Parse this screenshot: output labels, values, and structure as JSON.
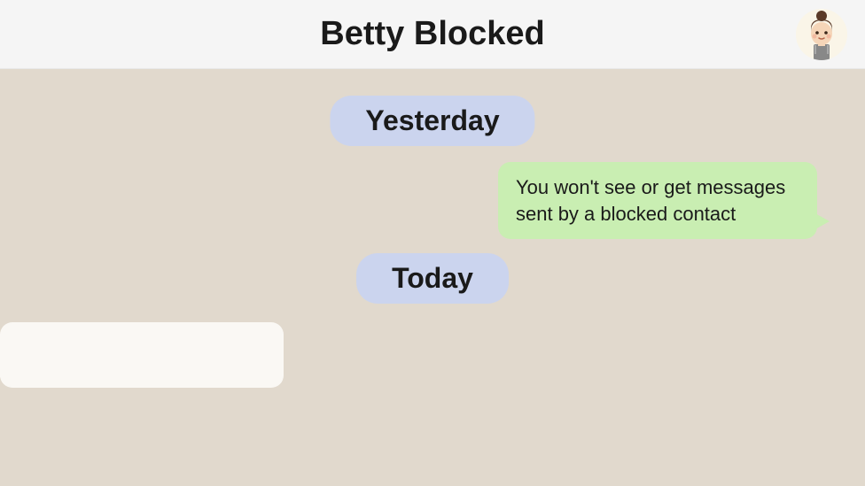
{
  "header": {
    "title": "Betty Blocked"
  },
  "dates": {
    "yesterday": "Yesterday",
    "today": "Today"
  },
  "messages": {
    "outgoing": "You won't see or get messages sent by a blocked contact",
    "incoming": ""
  }
}
